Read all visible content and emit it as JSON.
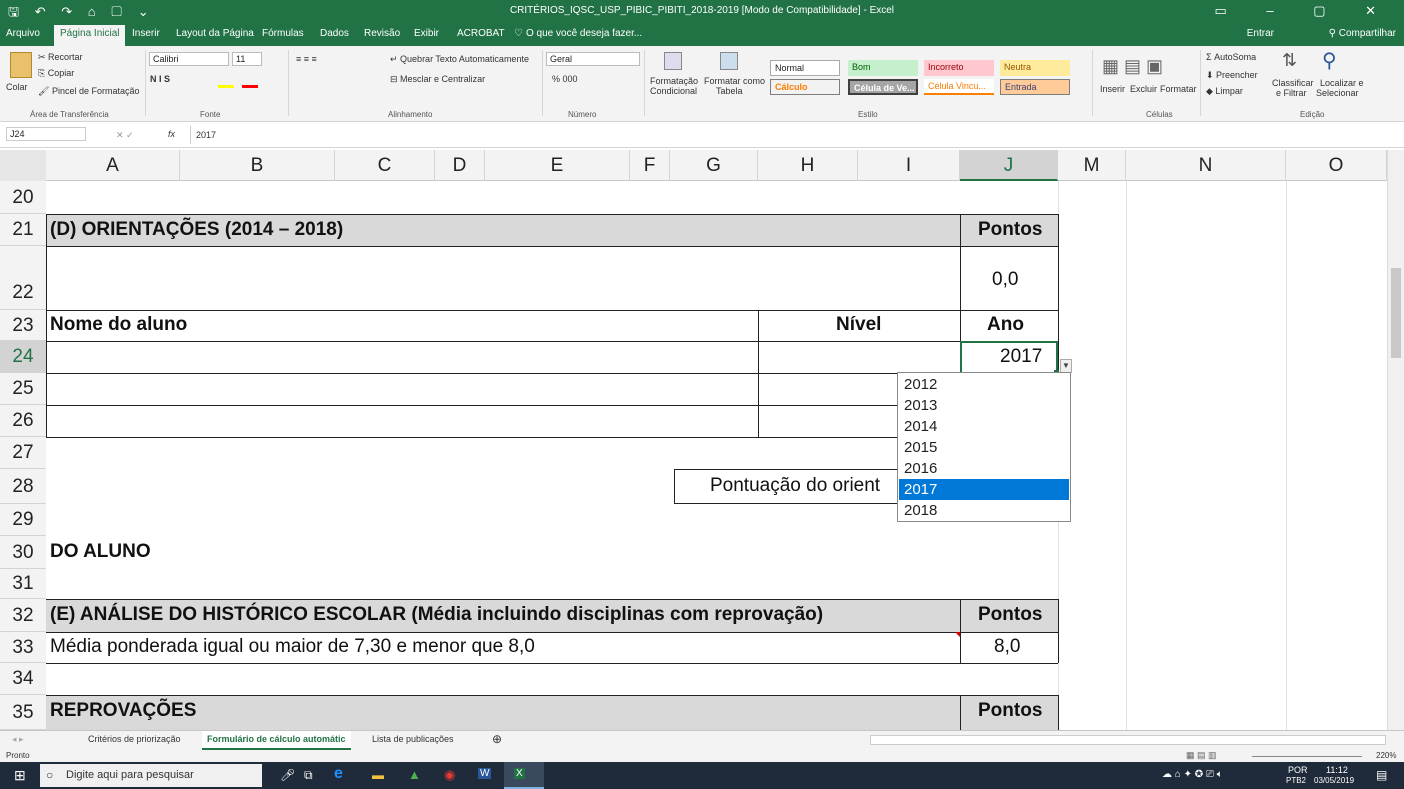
{
  "titlebar": {
    "title": "CRITÉRIOS_IQSC_USP_PIBIC_PIBITI_2018-2019  [Modo de Compatibilidade]  -  Excel",
    "quick_access": "🖫 ↶ ↷ ⌂ ▢ ⌄",
    "window_controls": "▭ – ▢ ✕"
  },
  "tabs": {
    "file": "Arquivo",
    "home": "Página Inicial",
    "insert": "Inserir",
    "layout": "Layout da Página",
    "formulas": "Fórmulas",
    "data": "Dados",
    "review": "Revisão",
    "view": "Exibir",
    "acrobat": "ACROBAT",
    "tell": "O que você deseja fazer...",
    "signin": "Entrar",
    "share": "Compartilhar"
  },
  "ribbon": {
    "paste": "Colar",
    "cut": "Recortar",
    "copy": "Copiar",
    "painter": "Pincel de Formatação",
    "clipboard": "Área de Transferência",
    "font_name": "Calibri",
    "font_size": "11",
    "font_group": "Fonte",
    "bold_italic": "N  I  S",
    "wrap": "Quebrar Texto Automaticamente",
    "merge": "Mesclar e Centralizar",
    "align_group": "Alinhamento",
    "numfmt": "Geral",
    "number_group": "Número",
    "pct": "% 000",
    "cond": "Formatação",
    "cond2": "Condicional",
    "table": "Formatar como",
    "table2": "Tabela",
    "styles": {
      "normal": "Normal",
      "bom": "Bom",
      "incorreto": "Incorreto",
      "neutra": "Neutra",
      "calculo": "Cálculo",
      "celula_ve": "Célula de Ve...",
      "celula_vinc": "Célula Vincu...",
      "entrada": "Entrada"
    },
    "style_group": "Estilo",
    "insert": "Inserir",
    "delete": "Excluir",
    "format": "Formatar",
    "cells_group": "Células",
    "autosum": "AutoSoma",
    "fill": "Preencher",
    "clear": "Limpar",
    "sort": "Classificar",
    "sort2": "e Filtrar",
    "find": "Localizar e",
    "find2": "Selecionar",
    "edit_group": "Edição"
  },
  "formula_bar": {
    "name_box": "J24",
    "fx": "fx",
    "value": "2017"
  },
  "columns": [
    "A",
    "B",
    "C",
    "D",
    "E",
    "F",
    "G",
    "H",
    "I",
    "J",
    "M",
    "N",
    "O"
  ],
  "rows": [
    "20",
    "21",
    "22",
    "23",
    "24",
    "25",
    "26",
    "27",
    "28",
    "29",
    "30",
    "31",
    "32",
    "33",
    "34",
    "35"
  ],
  "cells": {
    "r21": "(D) ORIENTAÇÕES (2014 – 2018)",
    "r21_pontos": "Pontos",
    "r22_val": "0,0",
    "r23_nome": "Nome do aluno",
    "r23_nivel": "Nível",
    "r23_ano": "Ano",
    "r24_ano": "2017",
    "r28": "Pontuação do orient",
    "r30": "DO ALUNO",
    "r32": "(E) ANÁLISE DO HISTÓRICO ESCOLAR (Média incluindo disciplinas com reprovação)",
    "r32_pontos": "Pontos",
    "r33": "Média ponderada igual ou maior de 7,30 e menor que 8,0",
    "r33_val": "8,0",
    "r35": "REPROVAÇÕES",
    "r35_pontos": "Pontos"
  },
  "dropdown": {
    "options": [
      "2012",
      "2013",
      "2014",
      "2015",
      "2016",
      "2017",
      "2018"
    ],
    "selected": "2017"
  },
  "sheets": {
    "tab1": "Critérios de priorização",
    "tab2": "Formulário de cálculo automátic",
    "tab3": "Lista de publicações"
  },
  "status": {
    "ready": "Pronto",
    "zoom": "220%"
  },
  "taskbar": {
    "search": "Digite aqui para pesquisar",
    "lang": "POR",
    "lang2": "PTB2",
    "time": "11:12",
    "date": "03/05/2019"
  }
}
